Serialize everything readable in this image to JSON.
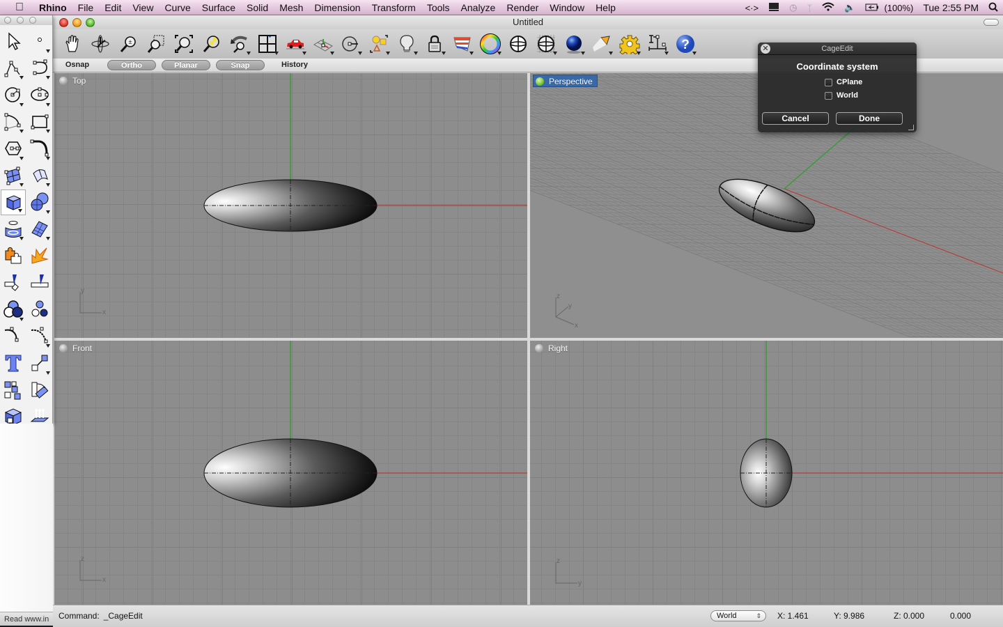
{
  "menubar": {
    "apple_icon": "apple-logo",
    "app_name": "Rhino",
    "items": [
      "File",
      "Edit",
      "View",
      "Curve",
      "Surface",
      "Solid",
      "Mesh",
      "Dimension",
      "Transform",
      "Tools",
      "Analyze",
      "Render",
      "Window",
      "Help"
    ],
    "status": {
      "battery_percent": "(100%)",
      "clock": "Tue 2:55 PM",
      "icons": [
        "script-arrows-icon",
        "display-icon",
        "time-machine-icon",
        "bluetooth-icon",
        "wifi-icon",
        "volume-icon",
        "battery-icon",
        "spotlight-search-icon"
      ]
    }
  },
  "window": {
    "title": "Untitled"
  },
  "toolbar": {
    "buttons": [
      {
        "name": "pan-icon",
        "tip": "Pan"
      },
      {
        "name": "rotate-view-icon",
        "tip": "Rotate"
      },
      {
        "name": "zoom-dynamic-icon",
        "tip": "Zoom"
      },
      {
        "name": "zoom-window-icon",
        "tip": "Zoom Window"
      },
      {
        "name": "zoom-extents-icon",
        "tip": "Zoom Extents"
      },
      {
        "name": "zoom-selected-icon",
        "tip": "Zoom Selected"
      },
      {
        "name": "undo-view-icon",
        "tip": "Undo View"
      },
      {
        "name": "four-viewports-icon",
        "tip": "4 Viewports"
      },
      {
        "name": "named-views-car-icon",
        "tip": "Named Views"
      },
      {
        "name": "cplane-icon",
        "tip": "CPlane"
      },
      {
        "name": "object-snap-icon",
        "tip": "Osnap"
      },
      {
        "name": "select-objects-icon",
        "tip": "Select"
      },
      {
        "name": "lights-icon",
        "tip": "Lights"
      },
      {
        "name": "lock-icon",
        "tip": "Lock"
      },
      {
        "name": "layers-icon",
        "tip": "Layers"
      },
      {
        "name": "color-wheel-icon",
        "tip": "Properties"
      },
      {
        "name": "wireframe-sphere-icon",
        "tip": "Wireframe"
      },
      {
        "name": "ghosted-sphere-icon",
        "tip": "Ghosted"
      },
      {
        "name": "render-sphere-icon",
        "tip": "Rendered"
      },
      {
        "name": "spotlight-icon",
        "tip": "Spotlight"
      },
      {
        "name": "settings-gear-icon",
        "tip": "Options"
      },
      {
        "name": "dimension-icon",
        "tip": "Dimensions"
      },
      {
        "name": "help-icon",
        "tip": "Help"
      }
    ]
  },
  "modes": [
    {
      "label": "Osnap",
      "on": false
    },
    {
      "label": "Ortho",
      "on": true
    },
    {
      "label": "Planar",
      "on": true
    },
    {
      "label": "Snap",
      "on": true
    },
    {
      "label": "History",
      "on": false
    }
  ],
  "viewports": {
    "top": {
      "label": "Top",
      "axis_h": "x",
      "axis_v": "y"
    },
    "perspective": {
      "label": "Perspective",
      "active": true,
      "axis_x": "x",
      "axis_y": "y",
      "axis_z": "z"
    },
    "front": {
      "label": "Front",
      "axis_h": "x",
      "axis_v": "z"
    },
    "right": {
      "label": "Right",
      "axis_h": "y",
      "axis_v": "z"
    }
  },
  "palette": {
    "tools": [
      "select-arrow-icon",
      "point-icon",
      "polyline-icon",
      "curve-icon",
      "circle-icon",
      "ellipse-icon",
      "arc-icon",
      "rectangle-icon",
      "polygon-icon",
      "fillet-curve-icon",
      "surface-from-points-icon",
      "extrude-surface-icon",
      "box-solid-icon",
      "sphere-solid-icon",
      "cylinder-icon",
      "mesh-surface-icon",
      "boolean-puzzle-icon",
      "explode-icon",
      "trim-icon",
      "split-icon",
      "boolean-union-icon",
      "group-icon",
      "fillet-edge-icon",
      "blend-curve-icon",
      "text-icon",
      "move-icon",
      "array-icon",
      "rotate-icon",
      "block-icon",
      "project-icon"
    ],
    "selected_index": 12
  },
  "command": {
    "prompt": "Command:",
    "value": "_CageEdit"
  },
  "coords": {
    "system": "World",
    "x": "X: 1.461",
    "y": "Y: 9.986",
    "z": "Z: 0.000",
    "d": "0.000"
  },
  "read_bar": "Read www.in",
  "dialog": {
    "title": "CageEdit",
    "heading": "Coordinate system",
    "options": [
      {
        "label": "CPlane",
        "checked": false
      },
      {
        "label": "World",
        "checked": false
      }
    ],
    "cancel_label": "Cancel",
    "done_label": "Done"
  },
  "colors": {
    "x_axis": "#b0403f",
    "y_axis": "#3f9a3a",
    "active_viewport": "#3a69a8",
    "viewport_bg": "#8d8d8d"
  }
}
